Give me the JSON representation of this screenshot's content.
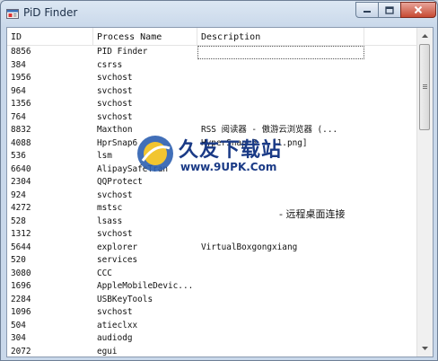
{
  "window": {
    "title": "PiD Finder",
    "controls": {
      "minimize_icon": "minimize-icon",
      "maximize_icon": "maximize-icon",
      "close_icon": "close-icon"
    }
  },
  "table": {
    "columns": [
      "ID",
      "Process Name",
      "Description"
    ],
    "rows": [
      {
        "id": "8856",
        "name": "PID Finder",
        "desc": ""
      },
      {
        "id": "384",
        "name": "csrss",
        "desc": ""
      },
      {
        "id": "1956",
        "name": "svchost",
        "desc": ""
      },
      {
        "id": "964",
        "name": "svchost",
        "desc": ""
      },
      {
        "id": "1356",
        "name": "svchost",
        "desc": ""
      },
      {
        "id": "764",
        "name": "svchost",
        "desc": ""
      },
      {
        "id": "8832",
        "name": "Maxthon",
        "desc": "RSS 阅读器 - 傲游云浏览器 (..."
      },
      {
        "id": "4088",
        "name": "HprSnap6",
        "desc": "HyperSnap 6 - [1.png]"
      },
      {
        "id": "536",
        "name": "lsm",
        "desc": ""
      },
      {
        "id": "6640",
        "name": "AlipaySafeTran",
        "desc": ""
      },
      {
        "id": "2304",
        "name": "QQProtect",
        "desc": ""
      },
      {
        "id": "924",
        "name": "svchost",
        "desc": ""
      },
      {
        "id": "4272",
        "name": "mstsc",
        "desc": ""
      },
      {
        "id": "528",
        "name": "lsass",
        "desc": ""
      },
      {
        "id": "1312",
        "name": "svchost",
        "desc": ""
      },
      {
        "id": "5644",
        "name": "explorer",
        "desc": "VirtualBoxgongxiang"
      },
      {
        "id": "520",
        "name": "services",
        "desc": ""
      },
      {
        "id": "3080",
        "name": "CCC",
        "desc": ""
      },
      {
        "id": "1696",
        "name": "AppleMobileDevic...",
        "desc": ""
      },
      {
        "id": "2284",
        "name": "USBKeyTools",
        "desc": ""
      },
      {
        "id": "1096",
        "name": "svchost",
        "desc": ""
      },
      {
        "id": "504",
        "name": "atieclxx",
        "desc": ""
      },
      {
        "id": "304",
        "name": "audiodg",
        "desc": ""
      },
      {
        "id": "2072",
        "name": "egui",
        "desc": ""
      }
    ]
  },
  "overlay": {
    "watermark_title": "久友下载站",
    "watermark_url": "www.9UPK.Com",
    "mstsc_desc": "- 远程桌面连接"
  },
  "scrollbar": {
    "up_icon": "scroll-up-icon",
    "down_icon": "scroll-down-icon"
  }
}
